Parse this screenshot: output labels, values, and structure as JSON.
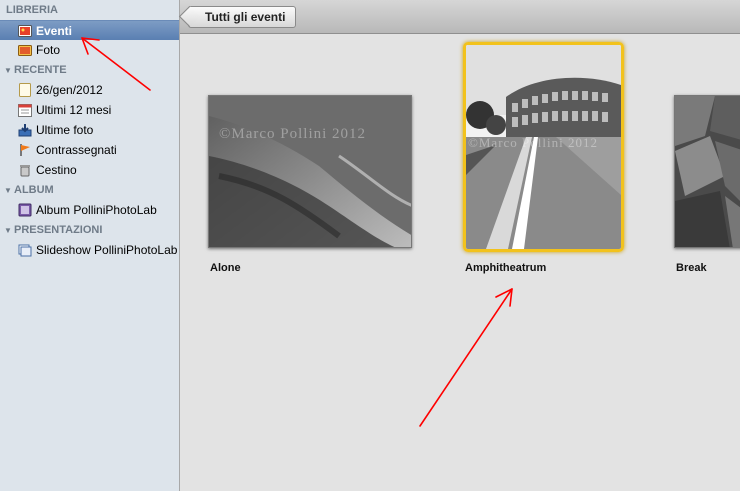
{
  "sidebar": {
    "libreria": {
      "title": "LIBRERIA",
      "items": [
        {
          "label": "Eventi",
          "icon": "events-icon",
          "selected": true
        },
        {
          "label": "Foto",
          "icon": "photos-icon"
        }
      ]
    },
    "recente": {
      "title": "RECENTE",
      "items": [
        {
          "label": "26/gen/2012",
          "icon": "event-page-icon"
        },
        {
          "label": "Ultimi 12 mesi",
          "icon": "calendar-icon"
        },
        {
          "label": "Ultime foto",
          "icon": "import-icon"
        },
        {
          "label": "Contrassegnati",
          "icon": "flag-icon"
        },
        {
          "label": "Cestino",
          "icon": "trash-icon"
        }
      ]
    },
    "album": {
      "title": "ALBUM",
      "items": [
        {
          "label": "Album PolliniPhotoLab",
          "icon": "album-icon"
        }
      ]
    },
    "presentazioni": {
      "title": "PRESENTAZIONI",
      "items": [
        {
          "label": "Slideshow PolliniPhotoLab",
          "icon": "slideshow-icon"
        }
      ]
    }
  },
  "toolbar": {
    "back_label": "Tutti gli eventi"
  },
  "events": [
    {
      "title": "Alone",
      "selected": false
    },
    {
      "title": "Amphitheatrum",
      "selected": true
    },
    {
      "title": "Break",
      "selected": false
    }
  ],
  "watermark": "©Marco Pollini 2012",
  "colors": {
    "selection_highlight": "#f2c21c",
    "sidebar_selected": "#5a7fb2",
    "annotation_arrow": "#ff0000"
  }
}
